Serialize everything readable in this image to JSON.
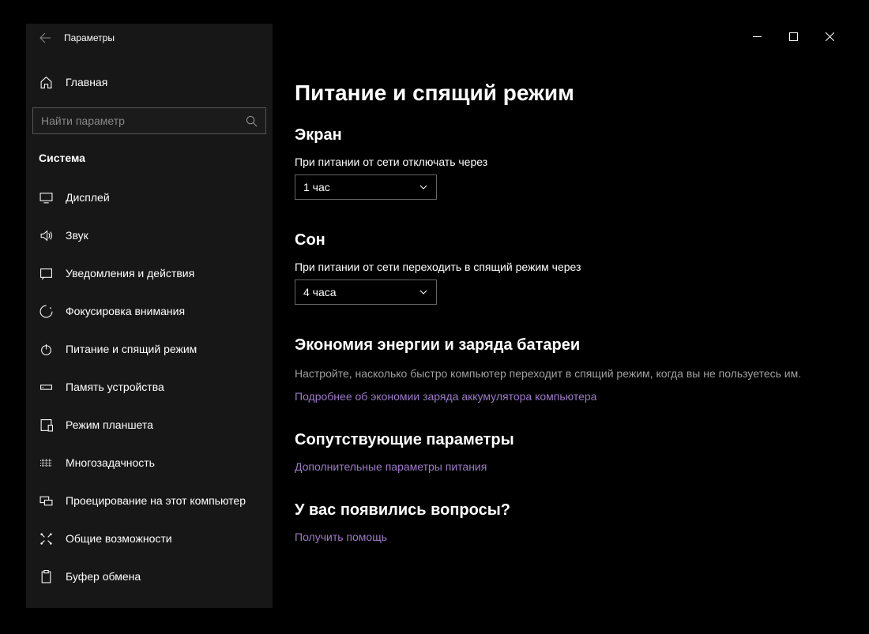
{
  "app": {
    "title": "Параметры"
  },
  "sidebar": {
    "home_label": "Главная",
    "search_placeholder": "Найти параметр",
    "category_label": "Система",
    "items": [
      {
        "label": "Дисплей"
      },
      {
        "label": "Звук"
      },
      {
        "label": "Уведомления и действия"
      },
      {
        "label": "Фокусировка внимания"
      },
      {
        "label": "Питание и спящий режим"
      },
      {
        "label": "Память устройства"
      },
      {
        "label": "Режим планшета"
      },
      {
        "label": "Многозадачность"
      },
      {
        "label": "Проецирование на этот компьютер"
      },
      {
        "label": "Общие возможности"
      },
      {
        "label": "Буфер обмена"
      }
    ]
  },
  "main": {
    "page_title": "Питание и спящий режим",
    "screen": {
      "heading": "Экран",
      "label": "При питании от сети отключать через",
      "value": "1 час"
    },
    "sleep": {
      "heading": "Сон",
      "label": "При питании от сети переходить в спящий режим через",
      "value": "4 часа"
    },
    "battery": {
      "heading": "Экономия энергии и заряда батареи",
      "text": "Настройте, насколько быстро компьютер переходит в спящий режим, когда вы не пользуетесь им.",
      "link": "Подробнее об экономии заряда аккумулятора компьютера"
    },
    "related": {
      "heading": "Сопутствующие параметры",
      "link": "Дополнительные параметры питания"
    },
    "help": {
      "heading": "У вас появились вопросы?",
      "link": "Получить помощь"
    }
  }
}
